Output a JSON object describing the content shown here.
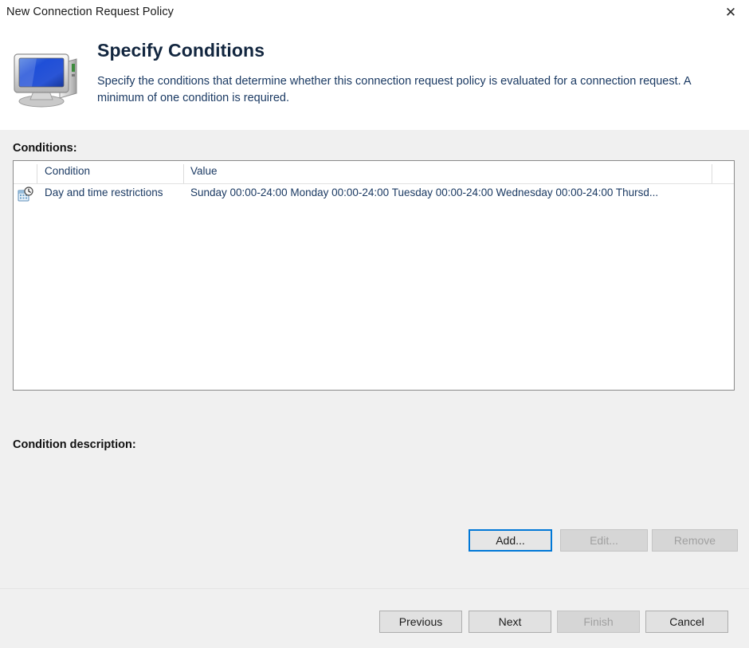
{
  "window": {
    "title": "New Connection Request Policy",
    "close_icon": "close-icon",
    "close_label": "✕"
  },
  "header": {
    "icon": "computer-monitor-icon",
    "title": "Specify Conditions",
    "description_line1": "Specify the conditions that determine whether this connection request policy is evaluated for a connection request. A",
    "description_line2": "minimum of one condition is required."
  },
  "conditions_section": {
    "label": "Conditions:",
    "columns": [
      "",
      "Condition",
      "Value"
    ],
    "rows": [
      {
        "icon": "day-time-restrictions-icon",
        "condition": "Day and time restrictions",
        "value": "Sunday 00:00-24:00 Monday 00:00-24:00 Tuesday 00:00-24:00 Wednesday 00:00-24:00 Thursd..."
      }
    ]
  },
  "condition_description": {
    "label": "Condition description:",
    "text": ""
  },
  "action_buttons": {
    "add": {
      "label": "Add...",
      "state": "focused"
    },
    "edit": {
      "label": "Edit...",
      "state": "disabled"
    },
    "remove": {
      "label": "Remove",
      "state": "disabled"
    }
  },
  "footer_buttons": {
    "previous": {
      "label": "Previous",
      "state": "enabled"
    },
    "next": {
      "label": "Next",
      "state": "enabled"
    },
    "finish": {
      "label": "Finish",
      "state": "disabled"
    },
    "cancel": {
      "label": "Cancel",
      "state": "enabled"
    }
  },
  "colors": {
    "accent_focus": "#0078d7",
    "header_text": "#12263f",
    "body_background": "#f0f0f0",
    "list_background": "#ffffff"
  }
}
